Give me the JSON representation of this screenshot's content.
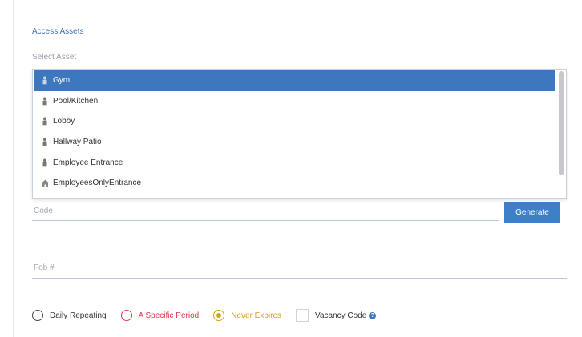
{
  "section_title": "Access Assets",
  "select_label": "Select Asset",
  "colors": {
    "accent": "#3d77bd",
    "selected_bg": "#3d77bd",
    "specific_period": "#d9394b",
    "never_expires": "#d4a317"
  },
  "assets": [
    {
      "label": "Gym",
      "icon": "person-icon",
      "selected": true
    },
    {
      "label": "Pool/Kitchen",
      "icon": "person-icon",
      "selected": false
    },
    {
      "label": "Lobby",
      "icon": "person-icon",
      "selected": false
    },
    {
      "label": "Hallway Patio",
      "icon": "person-icon",
      "selected": false
    },
    {
      "label": "Employee Entrance",
      "icon": "person-icon",
      "selected": false
    },
    {
      "label": "EmployeesOnlyEntrance",
      "icon": "home-icon",
      "selected": false
    }
  ],
  "code": {
    "placeholder": "Code",
    "value": ""
  },
  "generate_label": "Generate",
  "fob": {
    "placeholder": "Fob #",
    "value": ""
  },
  "options": {
    "daily_repeating": "Daily Repeating",
    "specific_period": "A Specific Period",
    "never_expires": "Never Expires",
    "vacancy_code": "Vacancy Code",
    "selected": "never_expires"
  }
}
